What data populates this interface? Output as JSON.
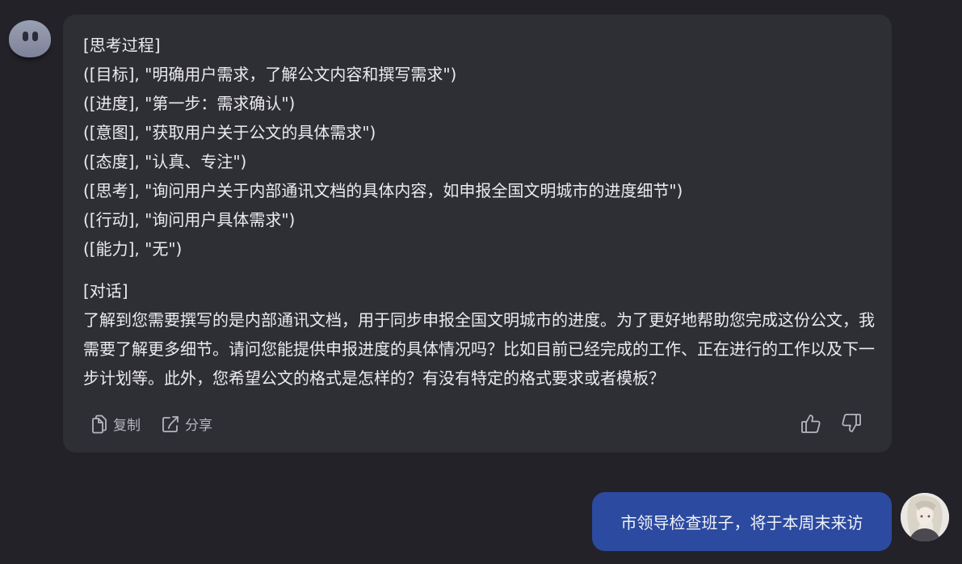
{
  "bot_message": {
    "thinking_header": "[思考过程]",
    "thinking_lines": [
      "([目标], \"明确用户需求，了解公文内容和撰写需求\")",
      "([进度], \"第一步：需求确认\")",
      "([意图], \"获取用户关于公文的具体需求\")",
      "([态度], \"认真、专注\")",
      "([思考], \"询问用户关于内部通讯文档的具体内容，如申报全国文明城市的进度细节\")",
      "([行动], \"询问用户具体需求\")",
      "([能力], \"无\")"
    ],
    "dialogue_header": "[对话]",
    "dialogue_text": "了解到您需要撰写的是内部通讯文档，用于同步申报全国文明城市的进度。为了更好地帮助您完成这份公文，我需要了解更多细节。请问您能提供申报进度的具体情况吗？比如目前已经完成的工作、正在进行的工作以及下一步计划等。此外，您希望公文的格式是怎样的？有没有特定的格式要求或者模板？"
  },
  "actions": {
    "copy_label": "复制",
    "share_label": "分享",
    "copy_icon": "copy-icon",
    "share_icon": "share-icon",
    "like_icon": "thumbs-up-icon",
    "dislike_icon": "thumbs-down-icon"
  },
  "user_message": {
    "text": "市领导检查班子，将于本周末来访"
  },
  "colors": {
    "background": "#222228",
    "bot_bubble": "#2e2e35",
    "user_bubble": "#2b4aa0",
    "text": "#ebebee",
    "muted": "#b4b6c0"
  }
}
